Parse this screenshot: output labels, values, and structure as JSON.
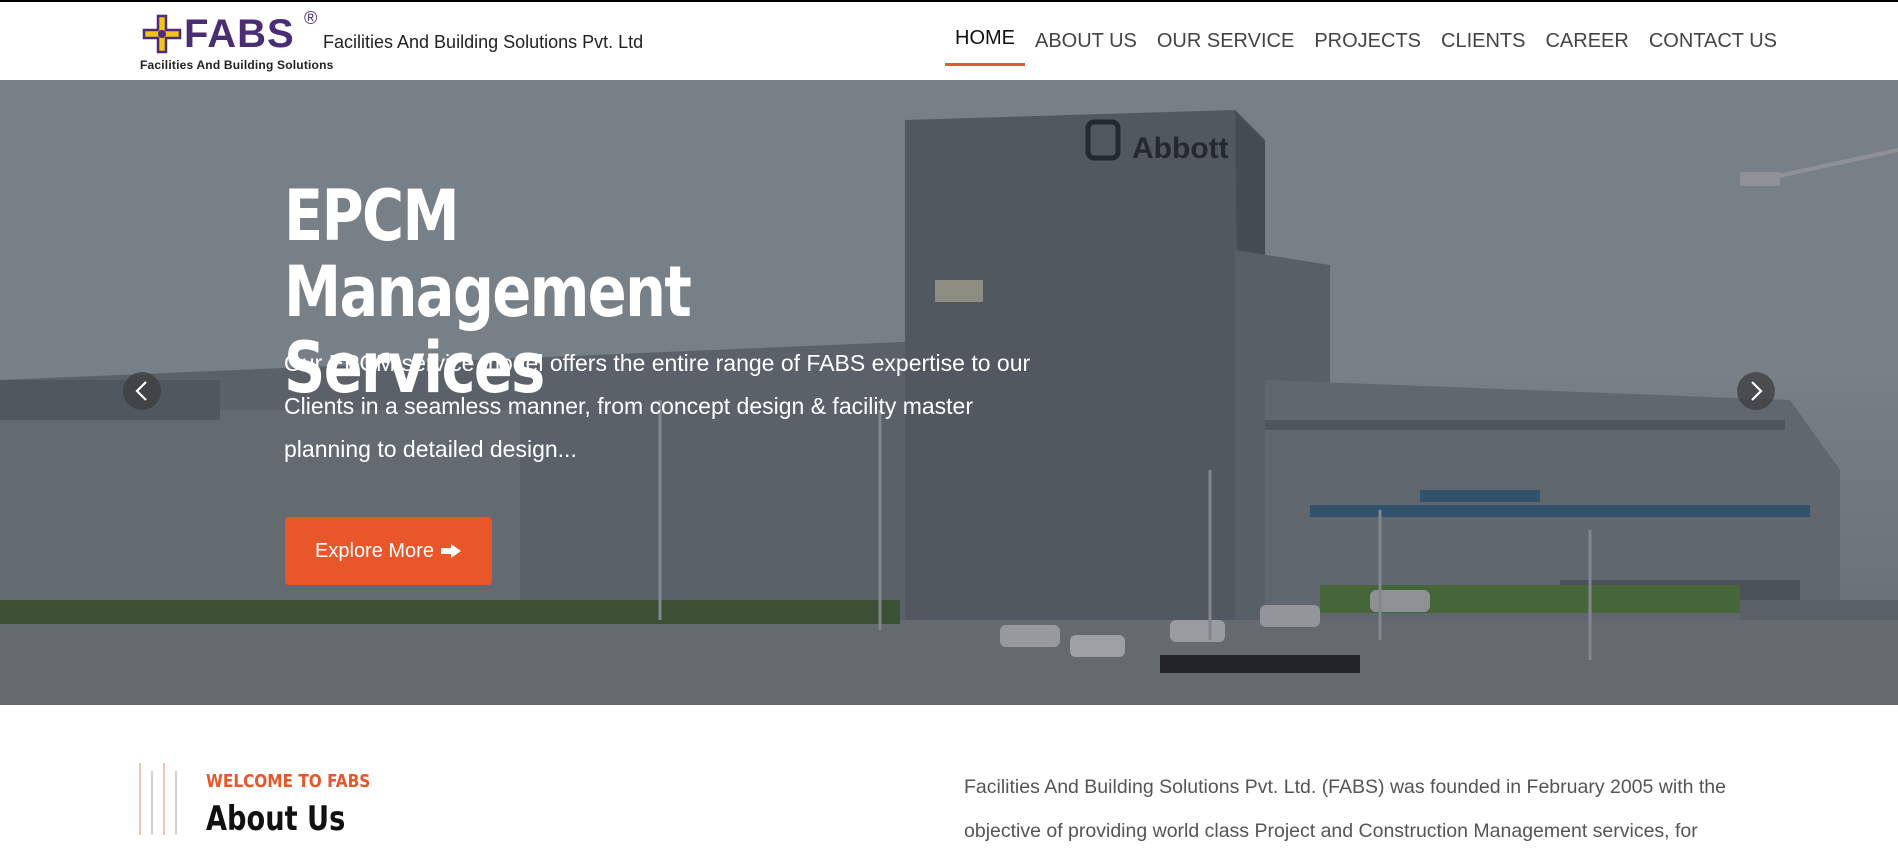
{
  "header": {
    "logo_text": "FABS",
    "logo_reg": "®",
    "logo_subtitle": "Facilities And Building Solutions",
    "company_name": "Facilities And Building Solutions Pvt. Ltd",
    "nav": [
      {
        "label": "HOME",
        "active": true
      },
      {
        "label": "ABOUT US",
        "active": false
      },
      {
        "label": "OUR SERVICE",
        "active": false
      },
      {
        "label": "PROJECTS",
        "active": false
      },
      {
        "label": "CLIENTS",
        "active": false
      },
      {
        "label": "CAREER",
        "active": false
      },
      {
        "label": "CONTACT US",
        "active": false
      }
    ]
  },
  "hero": {
    "title": "EPCM Management Services",
    "description": "Our EPCM service model offers the entire range of FABS expertise to our Clients in a seamless manner, from concept design & facility master planning to detailed design...",
    "button_label": "Explore More",
    "button_icon": "arrow-right-icon",
    "building_sign": "Abbott",
    "prev_icon": "chevron-left-icon",
    "next_icon": "chevron-right-icon"
  },
  "about": {
    "eyebrow": "WELCOME TO FABS",
    "title": "About Us",
    "text": "Facilities And Building Solutions Pvt. Ltd. (FABS) was founded in February 2005 with the objective of providing world class Project and Construction Management services, for"
  },
  "colors": {
    "accent": "#e8562a",
    "brand_purple": "#4a2d73",
    "logo_yellow": "#f2c318"
  }
}
